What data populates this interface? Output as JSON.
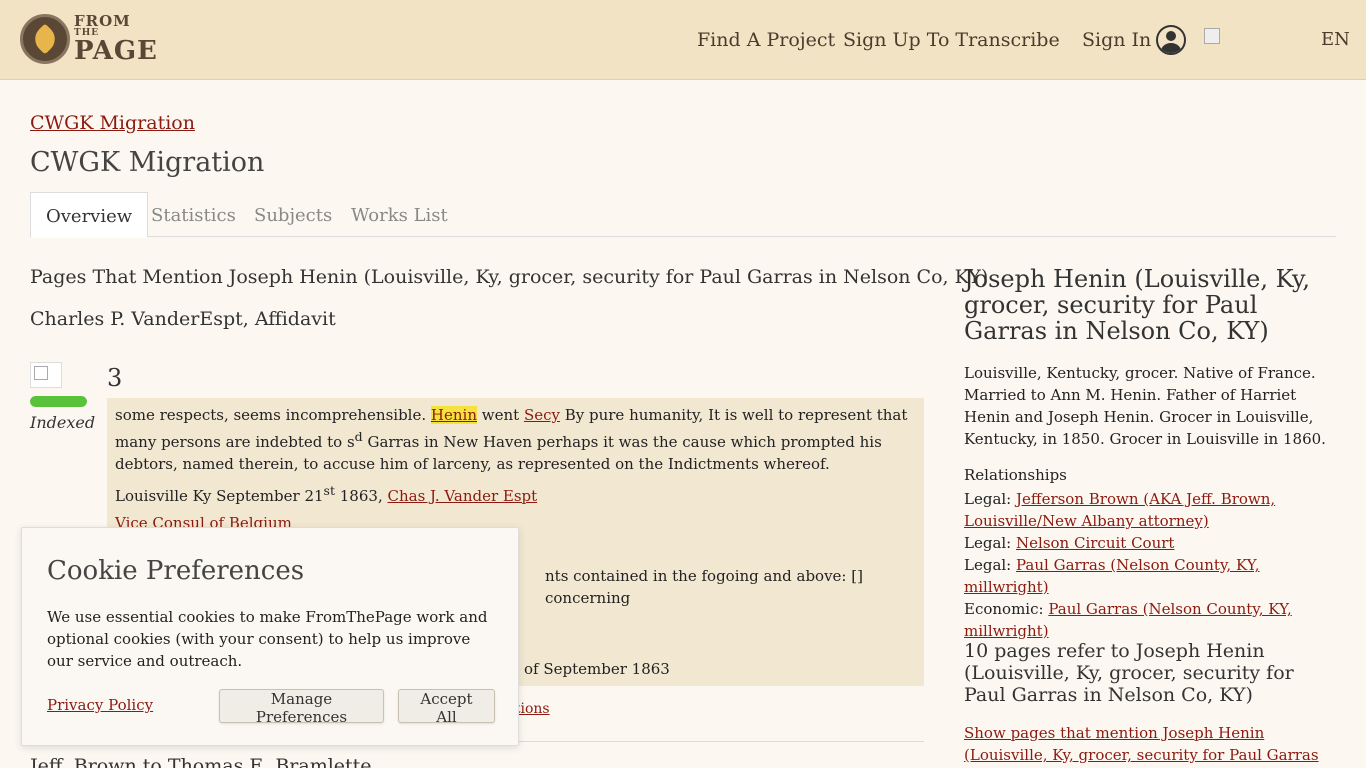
{
  "header": {
    "logo": {
      "line1": "FROM",
      "line2": "THE",
      "line3": "PAGE"
    },
    "nav": {
      "find_project": "Find A Project",
      "sign_up": "Sign Up To Transcribe",
      "sign_in": "Sign In"
    },
    "language": "EN"
  },
  "breadcrumb": "CWGK Migration",
  "page_title": "CWGK Migration",
  "tabs": [
    "Overview",
    "Statistics",
    "Subjects",
    "Works List"
  ],
  "main": {
    "heading": "Pages That Mention Joseph Henin (Louisville, Ky, grocer, security for Paul Garras in Nelson Co, KY)",
    "work_title": "Charles P. VanderEspt, Affidavit",
    "status": "Indexed",
    "progress_fraction": 1.0,
    "page_number": "3",
    "excerpt": {
      "p1_a": "some respects, seems incomprehensible. ",
      "p1_highlight": "Henin",
      "p1_b": " went ",
      "p1_link": "Secy",
      "p1_c": " By pure humanity, It is well to represent that many persons are indebted to s",
      "p1_sup": "d",
      "p1_d": " Garras in New Haven perhaps it was the cause which prompted his debtors, named therein, to accuse him of larceny, as represented on the Indictments whereof.",
      "p2_a": "Louisville Ky September 21",
      "p2_sup": "st",
      "p2_b": " 1863, ",
      "p2_link": "Chas J. Vander Espt",
      "p3_a": "Vice Consul of ",
      "p3_link": "Belgium",
      "p4": "nts contained in the fogoing and above: [] concerning",
      "p5": "of September 1863"
    },
    "corrections_link": "ctions",
    "next_title": "Jeff. Brown to Thomas E. Bramlette"
  },
  "sidebar": {
    "title": "Joseph Henin (Louisville, Ky, grocer, security for Paul Garras in Nelson Co, KY)",
    "description": "Louisville, Kentucky, grocer. Native of France. Married to Ann M. Henin. Father of Harriet Henin and Joseph Henin. Grocer in Louisville, Kentucky, in 1850. Grocer in Louisville in 1860.",
    "relationships_heading": "Relationships",
    "relationships": [
      {
        "type": "Legal:",
        "label": "Jefferson Brown (AKA Jeff. Brown, Louisville/New Albany attorney)"
      },
      {
        "type": "Legal:",
        "label": "Nelson Circuit Court"
      },
      {
        "type": "Legal:",
        "label": "Paul Garras (Nelson County, KY, millwright)"
      },
      {
        "type": "Economic:",
        "label": "Paul Garras (Nelson County, KY, millwright)"
      }
    ],
    "refer_heading": "10 pages refer to Joseph Henin (Louisville, Ky, grocer, security for Paul Garras in Nelson Co, KY)",
    "show_pages": "Show pages that mention Joseph Henin (Louisville, Ky, grocer, security for Paul Garras in Nelson Co,"
  },
  "cookie": {
    "title": "Cookie Preferences",
    "body": "We use essential cookies to make FromThePage work and optional cookies (with your consent) to help us improve our service and outreach.",
    "privacy": "Privacy Policy",
    "manage": "Manage Preferences",
    "accept": "Accept All"
  }
}
